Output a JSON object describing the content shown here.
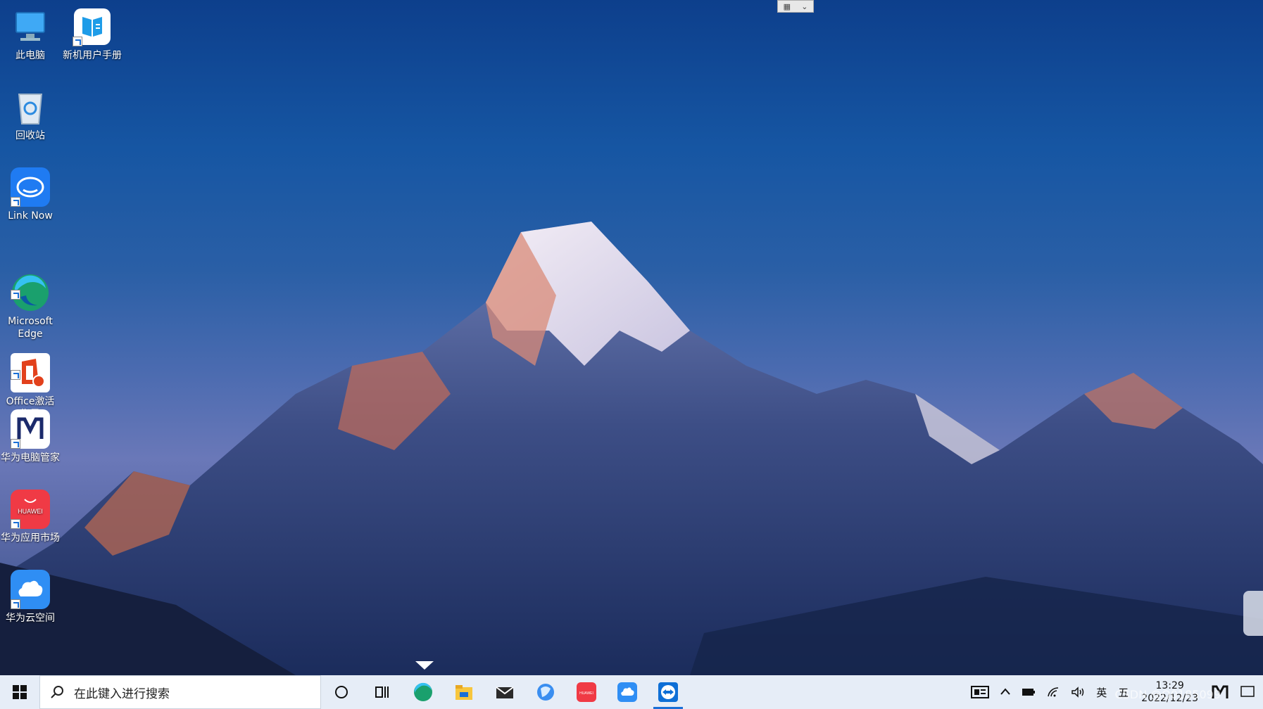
{
  "desktop_icons": [
    {
      "label": "此电脑",
      "icon": "computer-icon"
    },
    {
      "label": "新机用户手册",
      "icon": "manual-icon"
    },
    {
      "label": "回收站",
      "icon": "recycle-bin-icon"
    },
    {
      "label": "Link Now",
      "icon": "link-now-icon"
    },
    {
      "label": "Microsoft\nEdge",
      "icon": "edge-icon"
    },
    {
      "label": "Office激活\n指导",
      "icon": "office-icon"
    },
    {
      "label": "华为电脑管家",
      "icon": "pc-manager-icon"
    },
    {
      "label": "华为应用市场",
      "icon": "app-market-icon"
    },
    {
      "label": "华为云空间",
      "icon": "cloud-space-icon"
    }
  ],
  "taskbar": {
    "search_placeholder": "在此键入进行搜索",
    "apps": [
      "cortana-icon",
      "task-view-icon",
      "edge-icon",
      "file-explorer-icon",
      "mail-icon",
      "browser-icon",
      "huawei-appgallery-icon",
      "cloud-icon",
      "teamviewer-icon"
    ]
  },
  "tray": {
    "ime_lang": "英",
    "ime_mode": "五",
    "time": "13:29",
    "date": "2022/12/23"
  },
  "watermark": "CSDN @Q0185099"
}
